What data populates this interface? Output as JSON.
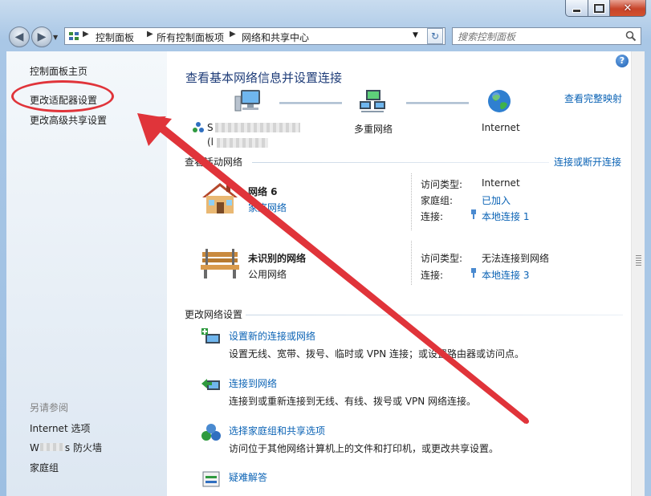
{
  "window": {
    "caption_minimize": "",
    "caption_maximize": "",
    "caption_close": "✕"
  },
  "nav": {
    "back": "◀",
    "forward": "▶",
    "breadcrumbs": [
      "控制面板",
      "所有控制面板项",
      "网络和共享中心"
    ],
    "refresh": "↻",
    "search_placeholder": "搜索控制面板"
  },
  "sidebar": {
    "items": [
      "控制面板主页",
      "更改适配器设置",
      "更改高级共享设置"
    ],
    "see_also_title": "另请参阅",
    "see_also": [
      "Internet 选项",
      "W",
      "s 防火墙",
      "家庭组"
    ]
  },
  "main": {
    "help": "?",
    "title": "查看基本网络信息并设置连接",
    "view_full_map": "查看完整映射",
    "map": {
      "computer_label": "S",
      "computer_sublabel": "(l",
      "network_label": "多重网络",
      "internet_label": "Internet"
    },
    "active_networks_title": "查看活动网络",
    "connect_disconnect": "连接或断开连接",
    "networks": [
      {
        "name": "网络  6",
        "type": "家庭网络",
        "access_type_label": "访问类型:",
        "access_type_value": "Internet",
        "homegroup_label": "家庭组:",
        "homegroup_value": "已加入",
        "connection_label": "连接:",
        "connection_value": "本地连接 1"
      },
      {
        "name": "未识别的网络",
        "type": "公用网络",
        "access_type_label": "访问类型:",
        "access_type_value": "无法连接到网络",
        "connection_label": "连接:",
        "connection_value": "本地连接 3"
      }
    ],
    "change_settings_title": "更改网络设置",
    "tasks": [
      {
        "title": "设置新的连接或网络",
        "desc": "设置无线、宽带、拨号、临时或 VPN 连接；或设置路由器或访问点。"
      },
      {
        "title": "连接到网络",
        "desc": "连接到或重新连接到无线、有线、拨号或 VPN 网络连接。"
      },
      {
        "title": "选择家庭组和共享选项",
        "desc": "访问位于其他网络计算机上的文件和打印机，或更改共享设置。"
      },
      {
        "title": "疑难解答",
        "desc": ""
      }
    ]
  },
  "colors": {
    "link": "#0b63b5",
    "title": "#1e3c78",
    "annotation": "#e0343a"
  }
}
